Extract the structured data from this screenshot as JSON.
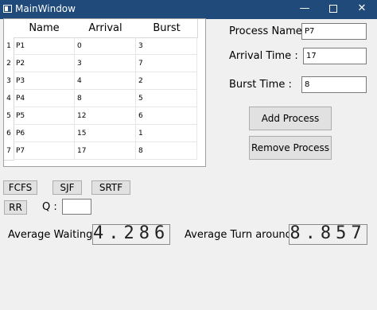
{
  "window": {
    "title": "MainWindow",
    "min_glyph": "—",
    "close_glyph": "✕"
  },
  "table": {
    "headers": [
      "Name",
      "Arrival",
      "Burst"
    ],
    "rows": [
      {
        "num": "1",
        "name": "P1",
        "arrival": "0",
        "burst": "3"
      },
      {
        "num": "2",
        "name": "P2",
        "arrival": "3",
        "burst": "7"
      },
      {
        "num": "3",
        "name": "P3",
        "arrival": "4",
        "burst": "2"
      },
      {
        "num": "4",
        "name": "P4",
        "arrival": "8",
        "burst": "5"
      },
      {
        "num": "5",
        "name": "P5",
        "arrival": "12",
        "burst": "6"
      },
      {
        "num": "6",
        "name": "P6",
        "arrival": "15",
        "burst": "1"
      },
      {
        "num": "7",
        "name": "P7",
        "arrival": "17",
        "burst": "8"
      }
    ]
  },
  "form": {
    "process_name_label": "Process Name :",
    "process_name_value": "P7",
    "arrival_label": "Arrival Time :",
    "arrival_value": "17",
    "burst_label": "Burst Time :",
    "burst_value": "8",
    "add_label": "Add Process",
    "remove_label": "Remove Process"
  },
  "algorithms": {
    "fcfs": "FCFS",
    "sjf": "SJF",
    "srtf": "SRTF",
    "rr": "RR",
    "quantum_label": "Q :",
    "quantum_value": ""
  },
  "results": {
    "avg_waiting_label": "Average Waiting :",
    "avg_waiting_value": "4.286",
    "avg_turnaround_label": "Average Turn around :",
    "avg_turnaround_value": "8.857"
  }
}
